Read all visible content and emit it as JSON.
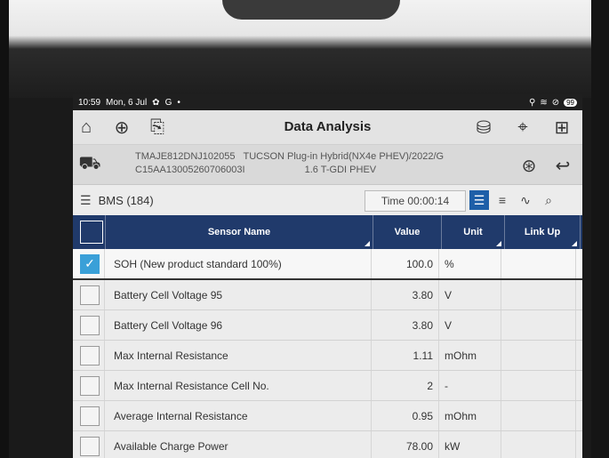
{
  "status_bar": {
    "time": "10:59",
    "date": "Mon, 6 Jul",
    "battery": "99"
  },
  "toolbar": {
    "title": "Data Analysis"
  },
  "vehicle": {
    "vin": "TMAJE812DNJ102055",
    "model": "TUCSON Plug-in Hybrid(NX4e PHEV)/2022/G",
    "engine": "1.6 T-GDI PHEV",
    "code": "C15AA13005260706003I"
  },
  "filter": {
    "group": "BMS (184)",
    "time": "Time 00:00:14"
  },
  "table": {
    "headers": {
      "name": "Sensor Name",
      "value": "Value",
      "unit": "Unit",
      "link": "Link Up"
    },
    "rows": [
      {
        "name": "SOH (New product standard 100%)",
        "value": "100.0",
        "unit": "%",
        "checked": true
      },
      {
        "name": "Battery Cell Voltage 95",
        "value": "3.80",
        "unit": "V",
        "checked": false
      },
      {
        "name": "Battery Cell Voltage 96",
        "value": "3.80",
        "unit": "V",
        "checked": false
      },
      {
        "name": "Max Internal Resistance",
        "value": "1.11",
        "unit": "mOhm",
        "checked": false
      },
      {
        "name": "Max Internal Resistance Cell No.",
        "value": "2",
        "unit": "-",
        "checked": false
      },
      {
        "name": "Average Internal Resistance",
        "value": "0.95",
        "unit": "mOhm",
        "checked": false
      },
      {
        "name": "Available Charge Power",
        "value": "78.00",
        "unit": "kW",
        "checked": false
      }
    ]
  },
  "accent_colors": {
    "header_bg": "#203a6b",
    "checkbox_checked": "#3aa0d8",
    "active_view": "#1e5fa8"
  }
}
